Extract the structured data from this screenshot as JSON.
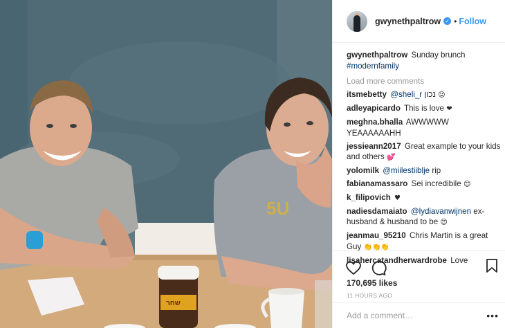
{
  "post": {
    "photo_alt": "",
    "username": "gwynethpaltrow",
    "follow_label": "Follow",
    "verified_icon": "verified-check-icon",
    "caption_user": "gwynethpaltrow",
    "caption_text": "Sunday brunch",
    "caption_hashtag": "#modernfamily",
    "load_more": "Load more comments",
    "comments": [
      {
        "user": "itsmebetty",
        "mention": "@sheli_r",
        "text": " נכון",
        "emoji": "😝"
      },
      {
        "user": "adleyapicardo",
        "mention": "",
        "text": "This is love",
        "emoji": "❤"
      },
      {
        "user": "meghna.bhalla",
        "mention": "",
        "text": "AWWWWW YEAAAAAAHH",
        "emoji": ""
      },
      {
        "user": "jessieann2017",
        "mention": "",
        "text": "Great example to your kids and others",
        "emoji": "💕"
      },
      {
        "user": "yolomilk",
        "mention": "@miilestiiblje",
        "text": " rip",
        "emoji": ""
      },
      {
        "user": "fabianamassaro",
        "mention": "",
        "text": "Sei incredibile",
        "emoji": "😊"
      },
      {
        "user": "k_filipovich",
        "mention": "",
        "text": "",
        "emoji": "♥"
      },
      {
        "user": "nadiesdamaiato",
        "mention": "@lydiavanwijnen",
        "text": " ex-husband & husband to be",
        "emoji": "😍"
      },
      {
        "user": "jeanmau_95210",
        "mention": "",
        "text": "Chris Martin is a great Guy",
        "emoji": "👏👏👏"
      },
      {
        "user": "lisahercatandherwardrobe",
        "mention": "",
        "text": "Love",
        "emoji": ""
      }
    ],
    "likes": "170,695 likes",
    "time": "11 HOURS AGO",
    "add_comment_placeholder": "Add a comment…",
    "more_label": "•••"
  },
  "colors": {
    "link_blue": "#3897f0",
    "hashtag": "#003569",
    "muted": "#999999",
    "border": "#efefef"
  }
}
